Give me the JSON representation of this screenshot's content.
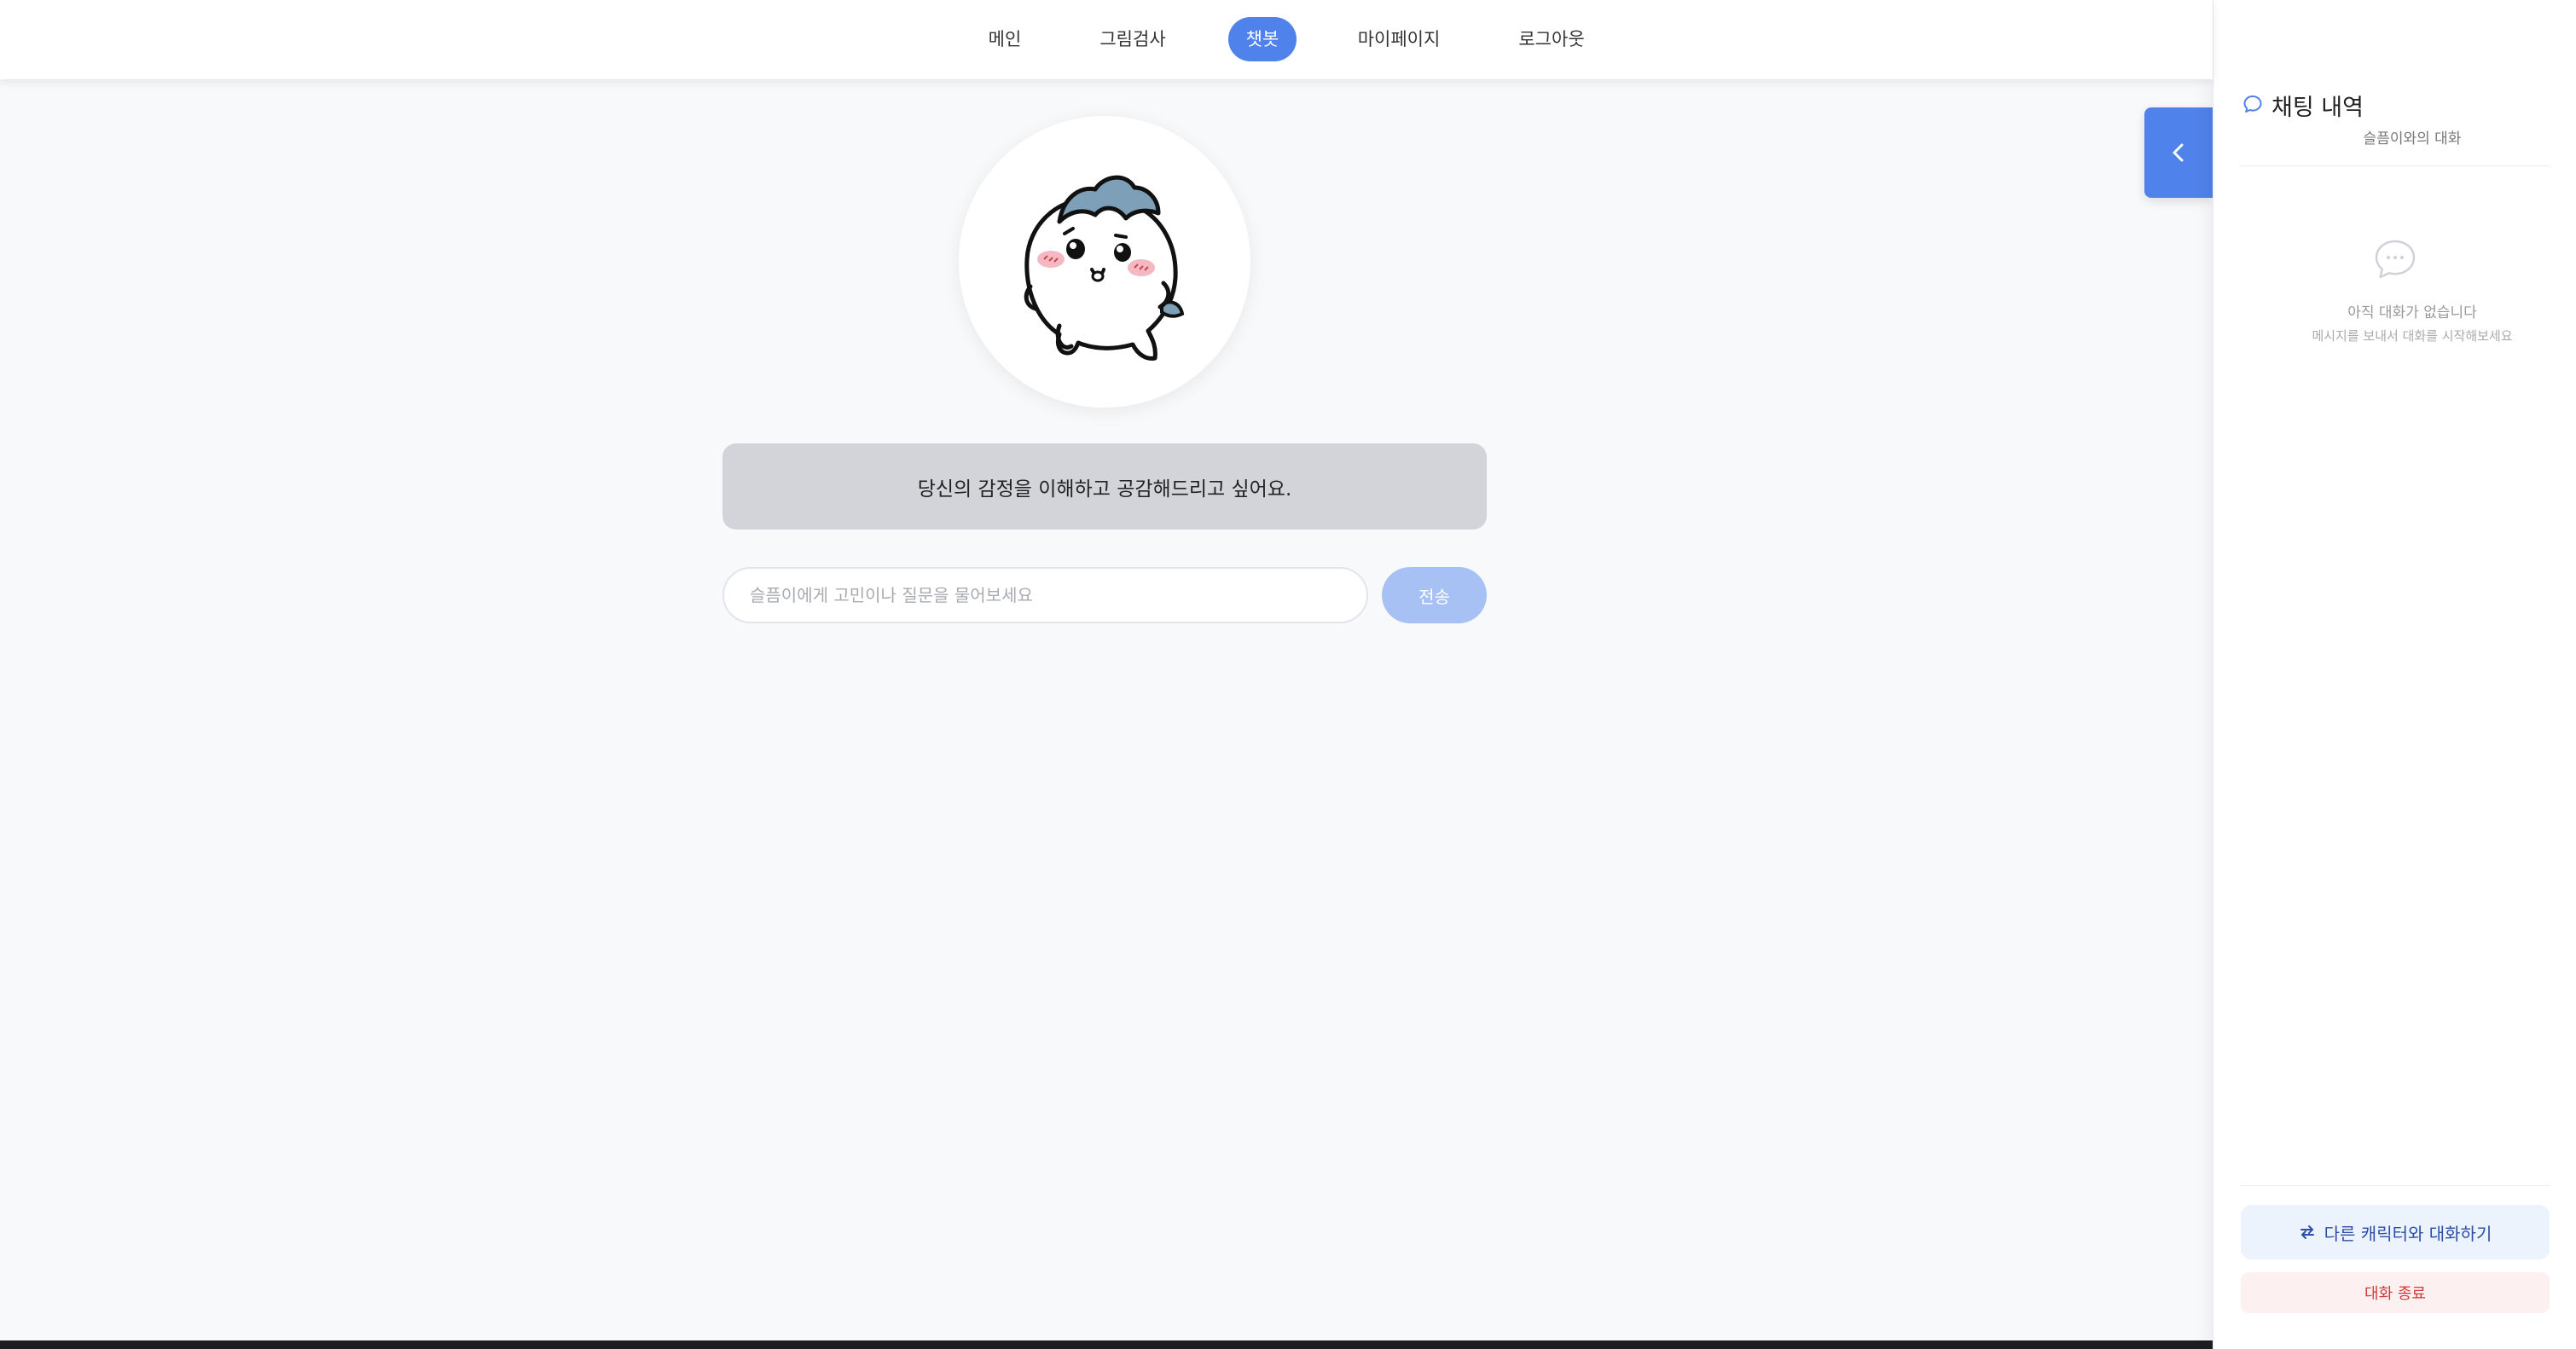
{
  "nav": {
    "items": [
      {
        "label": "메인",
        "active": false
      },
      {
        "label": "그림검사",
        "active": false
      },
      {
        "label": "챗봇",
        "active": true
      },
      {
        "label": "마이페이지",
        "active": false
      },
      {
        "label": "로그아웃",
        "active": false
      }
    ]
  },
  "chat": {
    "message": "당신의 감정을 이해하고 공감해드리고 싶어요.",
    "input_placeholder": "슬픔이에게 고민이나 질문을 물어보세요",
    "input_value": "",
    "send_label": "전송"
  },
  "panel": {
    "title": "채팅 내역",
    "subtitle": "슬픔이와의 대화",
    "empty_title": "아직 대화가 없습니다",
    "empty_subtitle": "메시지를 보내서 대화를 시작해보세요",
    "switch_label": "다른 캐릭터와 대화하기",
    "end_label": "대화 종료"
  },
  "colors": {
    "accent": "#4f82ea",
    "send_disabled": "#a8c1f4",
    "bubble": "#d2d4d9",
    "end_text": "#d23a3a"
  },
  "icons": {
    "panel_header": "chat-bubble-icon",
    "empty": "chat-dots-icon",
    "switch": "swap-arrows-icon",
    "toggle": "chevron-left-icon"
  }
}
